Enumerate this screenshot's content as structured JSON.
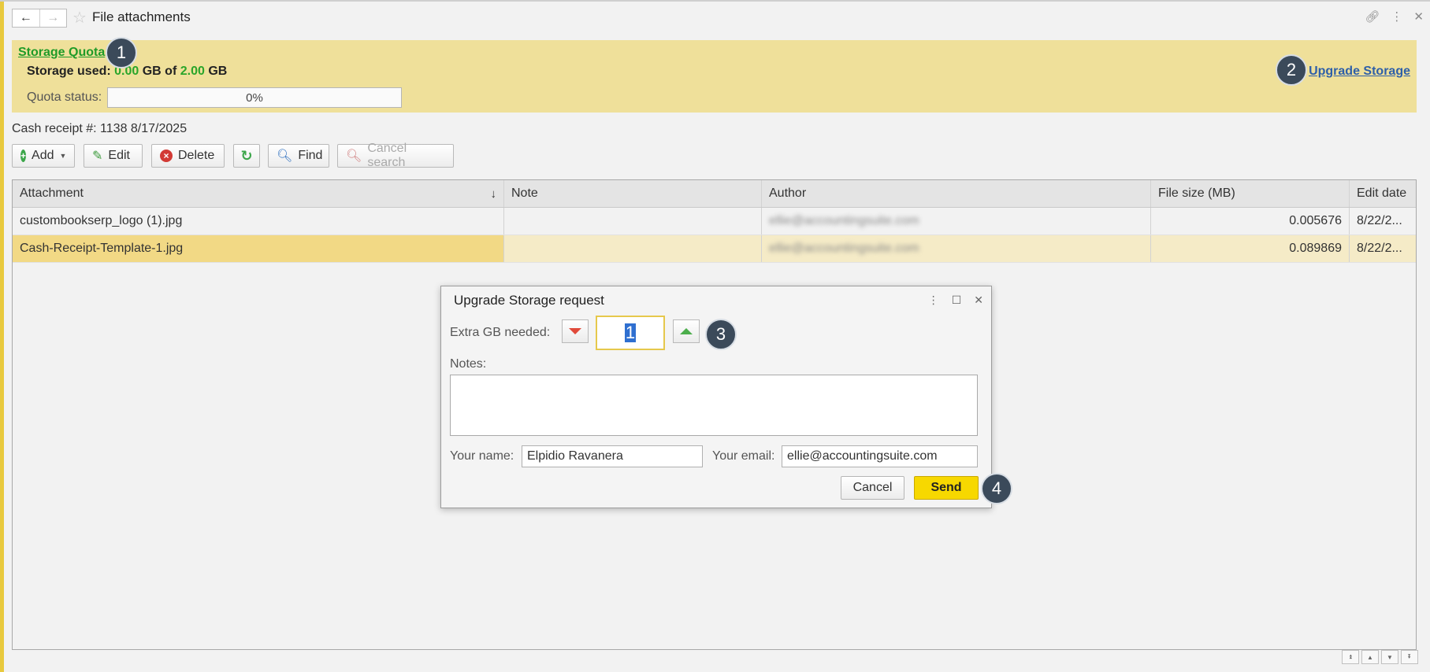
{
  "window": {
    "title": "File attachments",
    "back_icon": "←",
    "forward_icon": "→"
  },
  "quota": {
    "title": "Storage Quota",
    "used_prefix": "Storage used:",
    "used_value": "0.00",
    "used_unit1": "GB of",
    "total_value": "2.00",
    "used_unit2": "GB",
    "status_label": "Quota status:",
    "progress_text": "0%",
    "progress_fraction": 0,
    "upgrade_link": "Upgrade Storage"
  },
  "receipt": "Cash receipt #: 1138 8/17/2025",
  "toolbar": {
    "add": "Add",
    "edit": "Edit",
    "delete": "Delete",
    "find": "Find",
    "cancel_search": "Cancel search"
  },
  "table": {
    "columns": [
      "Attachment",
      "Note",
      "Author",
      "File size (MB)",
      "Edit date"
    ],
    "sort_indicator": "↓",
    "rows": [
      {
        "attachment": "custombookserp_logo (1).jpg",
        "note": "",
        "author": "ellie@accountingsuite.com",
        "size": "0.005676",
        "date": "8/22/2..."
      },
      {
        "attachment": "Cash-Receipt-Template-1.jpg",
        "note": "",
        "author": "ellie@accountingsuite.com",
        "size": "0.089869",
        "date": "8/22/2..."
      }
    ]
  },
  "dialog": {
    "title": "Upgrade Storage request",
    "extra_label": "Extra GB needed:",
    "extra_value": "1",
    "notes_label": "Notes:",
    "notes_value": "",
    "name_label": "Your name:",
    "name_value": "Elpidio Ravanera",
    "email_label": "Your email:",
    "email_value": "ellie@accountingsuite.com",
    "cancel": "Cancel",
    "send": "Send"
  },
  "markers": [
    "1",
    "2",
    "3",
    "4"
  ],
  "colors": {
    "banner": "#efe09a",
    "quota_link": "#1f9b28",
    "upgrade_link": "#2e5fa8",
    "send_button": "#f7d800",
    "selected_row": "#f2d985",
    "marker": "#3b4a5a"
  }
}
